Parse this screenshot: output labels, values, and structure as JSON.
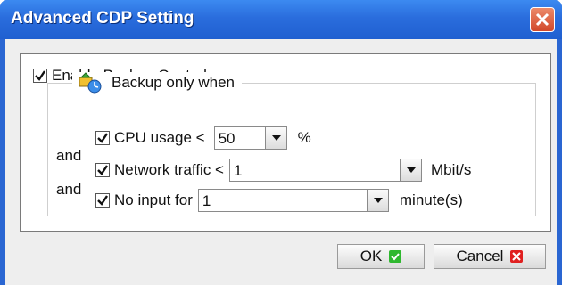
{
  "window": {
    "title": "Advanced CDP Setting"
  },
  "enable_backup_control": {
    "label": "Enable Backup Control",
    "checked": true
  },
  "backup_group": {
    "title": "Backup only when",
    "and_label_1": "and",
    "and_label_2": "and",
    "cpu": {
      "label": "CPU usage <",
      "checked": true,
      "value": "50",
      "unit": "%"
    },
    "network": {
      "label": "Network traffic <",
      "checked": true,
      "value": "1",
      "unit": "Mbit/s"
    },
    "no_input": {
      "label": "No input for",
      "checked": true,
      "value": "1",
      "unit": "minute(s)"
    }
  },
  "buttons": {
    "ok_label": "OK",
    "cancel_label": "Cancel"
  },
  "colors": {
    "title_bar": "#2a6ddd",
    "ok_icon": "#2fb82f",
    "cancel_icon": "#e02020"
  },
  "icons": {
    "close": "close-icon",
    "backup": "backup-icon",
    "ok": "check-icon",
    "cancel": "x-icon"
  }
}
